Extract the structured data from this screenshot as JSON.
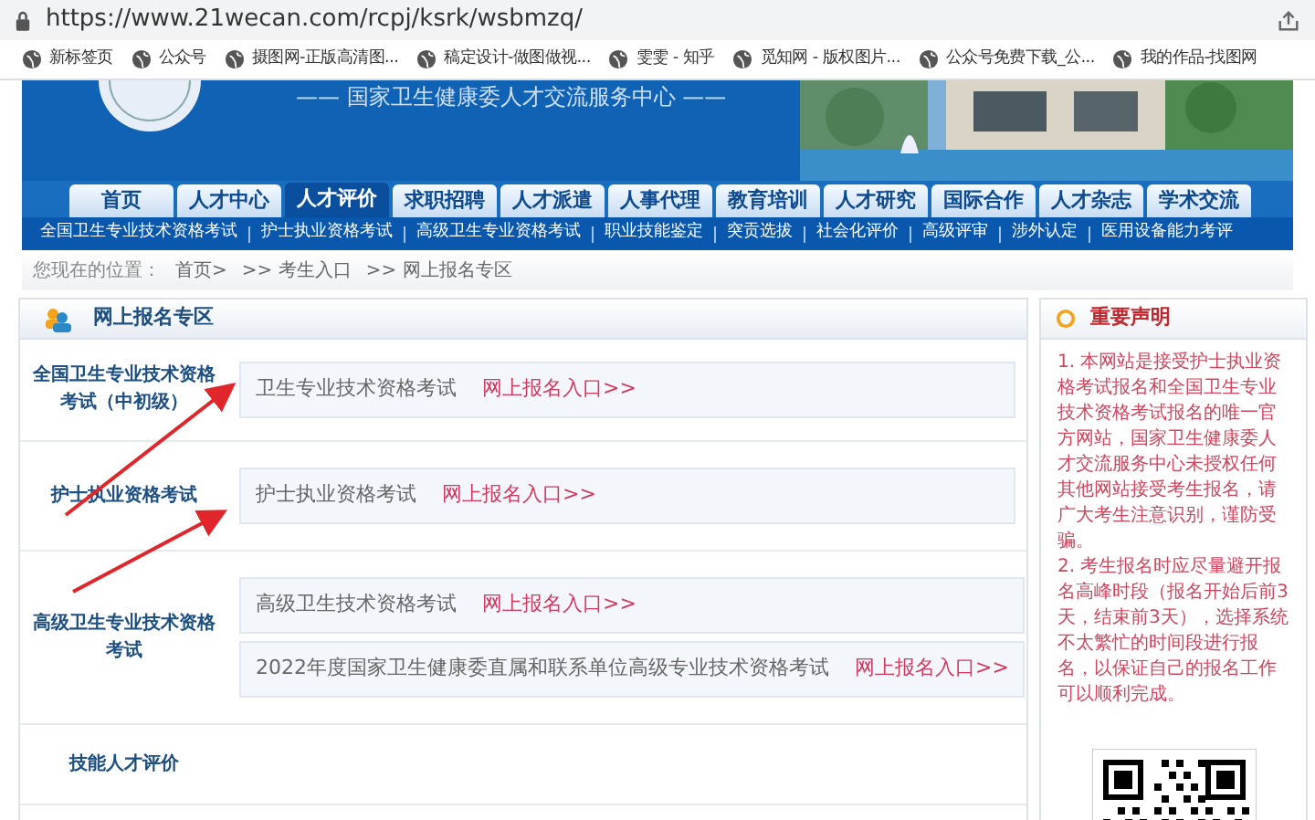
{
  "address_bar": {
    "url": "https://www.21wecan.com/rcpj/ksrk/wsbmzq/"
  },
  "bookmarks": [
    "新标签页",
    "公众号",
    "摄图网-正版高清图...",
    "稿定设计-做图做视...",
    "雯雯 - 知乎",
    "觅知网 - 版权图片...",
    "公众号免费下载_公...",
    "我的作品-找图网"
  ],
  "banner": {
    "subtitle": "—— 国家卫生健康委人才交流服务中心 ——"
  },
  "nav_tabs": [
    {
      "label": "首页",
      "selected": false
    },
    {
      "label": "人才中心",
      "selected": false
    },
    {
      "label": "人才评价",
      "selected": true
    },
    {
      "label": "求职招聘",
      "selected": false
    },
    {
      "label": "人才派遣",
      "selected": false
    },
    {
      "label": "人事代理",
      "selected": false
    },
    {
      "label": "教育培训",
      "selected": false
    },
    {
      "label": "人才研究",
      "selected": false
    },
    {
      "label": "国际合作",
      "selected": false
    },
    {
      "label": "人才杂志",
      "selected": false
    },
    {
      "label": "学术交流",
      "selected": false
    }
  ],
  "sub_nav": [
    "全国卫生专业技术资格考试",
    "护士执业资格考试",
    "高级卫生专业资格考试",
    "职业技能鉴定",
    "突贡选拔",
    "社会化评价",
    "高级评审",
    "涉外认定",
    "医用设备能力考评"
  ],
  "breadcrumb": {
    "label": "您现在的位置：",
    "items": [
      "首页>",
      ">> 考生入口",
      ">> 网上报名专区"
    ]
  },
  "registration": {
    "title": "网上报名专区",
    "sections": [
      {
        "label": "全国卫生专业技术资格考试（中初级）",
        "entries": [
          {
            "name": "卫生专业技术资格考试",
            "link": "网上报名入口>>"
          }
        ]
      },
      {
        "label": "护士执业资格考试",
        "entries": [
          {
            "name": "护士执业资格考试",
            "link": "网上报名入口>>"
          }
        ]
      },
      {
        "label": "高级卫生专业技术资格考试",
        "entries": [
          {
            "name": "高级卫生技术资格考试",
            "link": "网上报名入口>>"
          },
          {
            "name": "2022年度国家卫生健康委直属和联系单位高级专业技术资格考试",
            "link": "网上报名入口>>"
          }
        ]
      },
      {
        "label": "技能人才评价"
      }
    ]
  },
  "notice": {
    "title": "重要声明",
    "paragraphs": [
      "1. 本网站是接受护士执业资格考试报名和全国卫生专业技术资格考试报名的唯一官方网站，国家卫生健康委人才交流服务中心未授权任何其他网站接受考生报名，请广大考生注意识别，谨防受骗。",
      "2. 考生报名时应尽量避开报名高峰时段（报名开始后前3天，结束前3天），选择系统不太繁忙的时间段进行报名，以保证自己的报名工作可以顺利完成。"
    ]
  }
}
